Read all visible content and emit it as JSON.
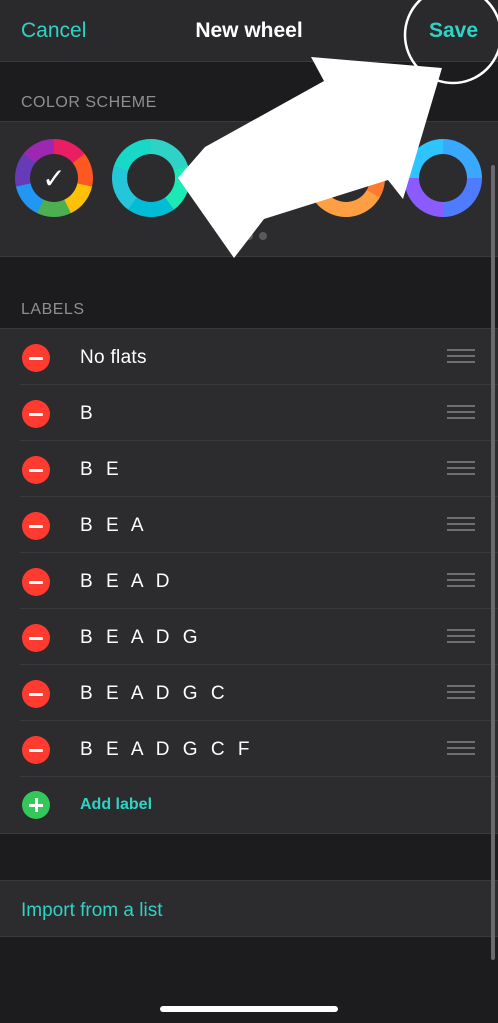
{
  "nav": {
    "cancel_label": "Cancel",
    "title": "New wheel",
    "save_label": "Save"
  },
  "color_scheme": {
    "header": "COLOR SCHEME",
    "selected_index": 0,
    "check_glyph": "✓",
    "page_count": 3,
    "active_page": 0,
    "swatches": [
      {
        "name": "rainbow",
        "colors": [
          "#e91e63",
          "#ff5722",
          "#ffc107",
          "#4caf50",
          "#2196f3",
          "#673ab7",
          "#9c27b0"
        ]
      },
      {
        "name": "teal",
        "colors": [
          "#2fd3c5",
          "#1de9b6",
          "#00bcd4",
          "#26c6da",
          "#18d8c8"
        ]
      },
      {
        "name": "red",
        "colors": [
          "#ff3b5c",
          "#ff5a7a",
          "#e8344d"
        ]
      },
      {
        "name": "orange",
        "colors": [
          "#ff7a2f",
          "#ff9f43",
          "#f25a1f"
        ]
      },
      {
        "name": "blue-purple",
        "colors": [
          "#3ba8ff",
          "#4f7cff",
          "#8a5cff",
          "#2ec4ff"
        ]
      }
    ]
  },
  "labels": {
    "header": "LABELS",
    "items": [
      {
        "label": "No flats"
      },
      {
        "label": "B"
      },
      {
        "label": "B E"
      },
      {
        "label": "B E A"
      },
      {
        "label": "B E A D"
      },
      {
        "label": "B E A D G"
      },
      {
        "label": "B E A D G C"
      },
      {
        "label": "B E A D G C F"
      }
    ],
    "add_label": "Add label"
  },
  "import": {
    "label": "Import from a list"
  },
  "colors": {
    "accent": "#2fd3c5",
    "delete": "#ff3b30",
    "add": "#34c759",
    "background": "#1c1c1e",
    "panel": "#2c2c2e"
  },
  "annotation": {
    "arrow_color": "#ffffff",
    "highlight_target": "save-button"
  }
}
